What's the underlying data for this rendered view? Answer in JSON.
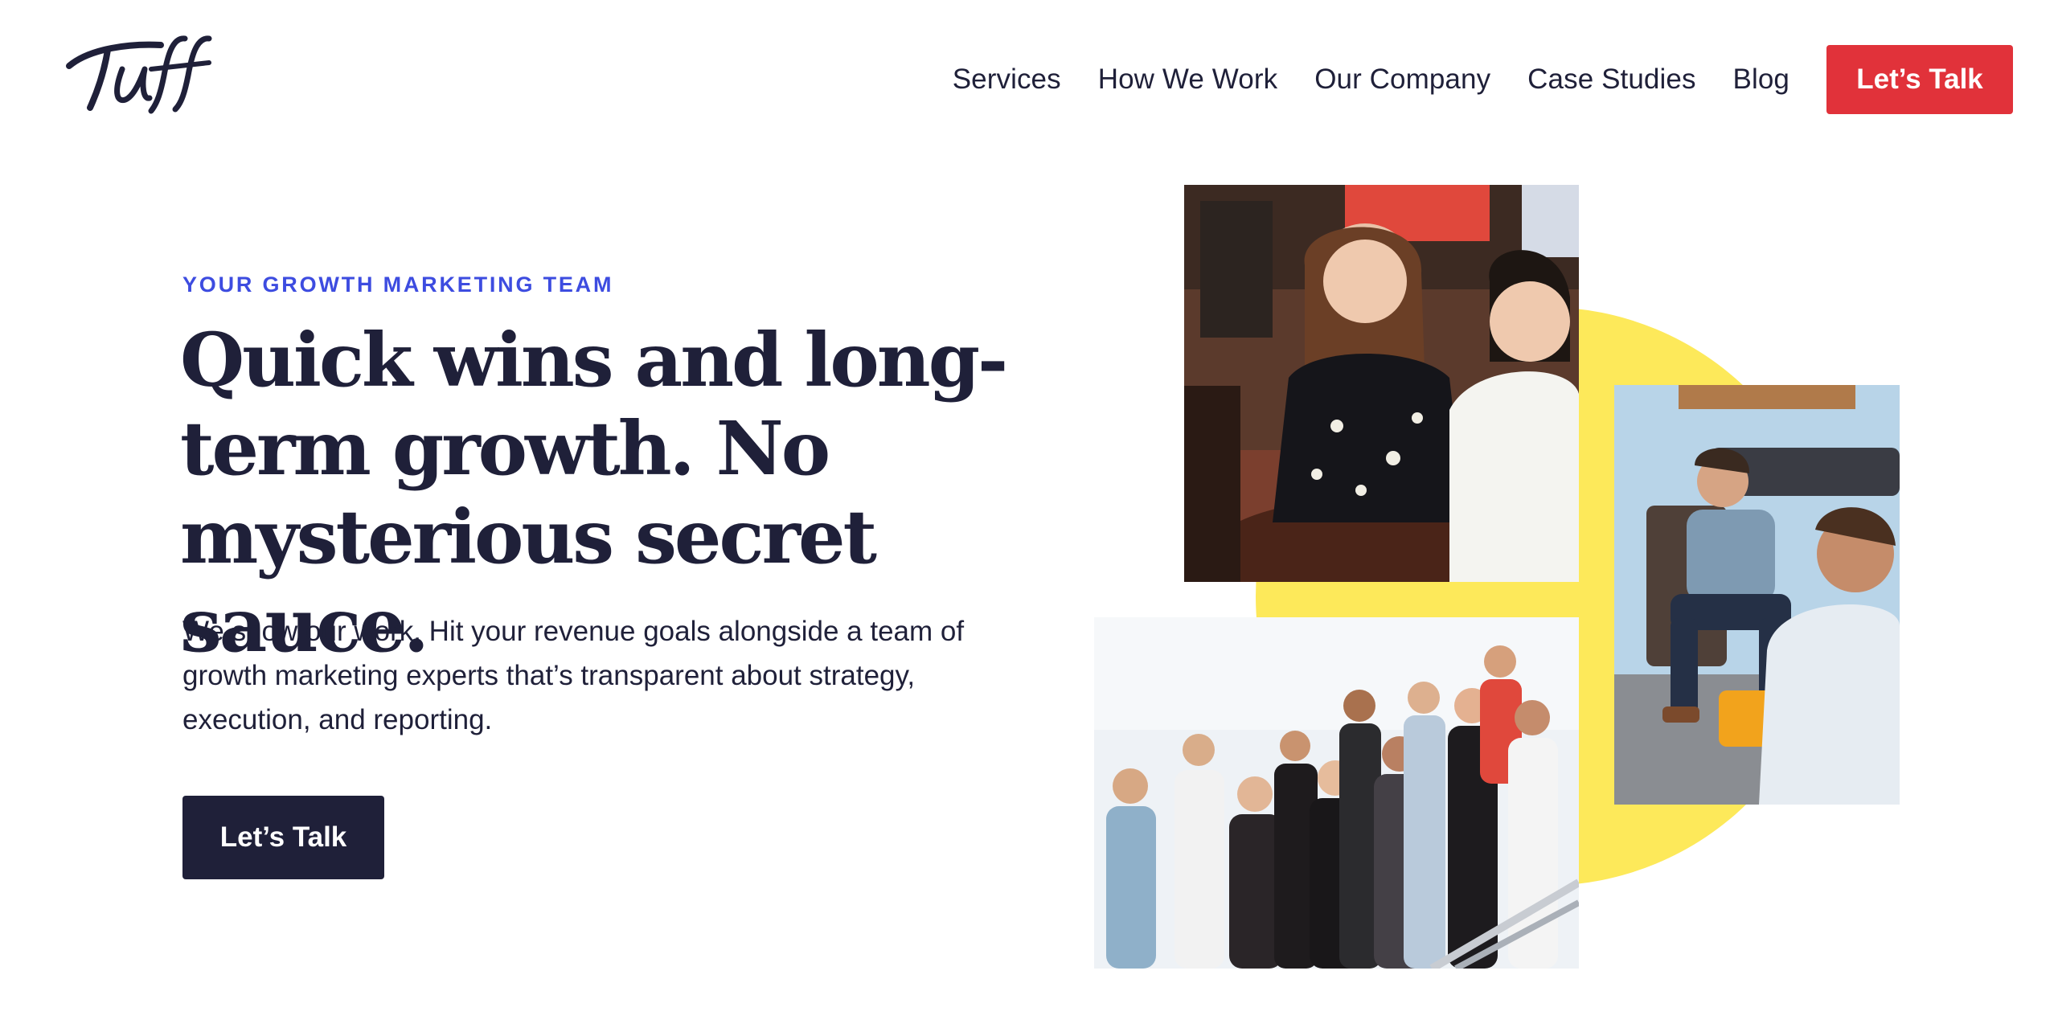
{
  "header": {
    "logo_text": "Tuff",
    "nav": [
      {
        "label": "Services"
      },
      {
        "label": "How We Work"
      },
      {
        "label": "Our Company"
      },
      {
        "label": "Case Studies"
      },
      {
        "label": "Blog"
      }
    ],
    "cta_label": "Let’s Talk"
  },
  "hero": {
    "eyebrow": "YOUR GROWTH MARKETING TEAM",
    "headline": "Quick wins and long-term growth. No mysterious secret sauce.",
    "subtext": "We show our work. Hit your revenue goals alongside a team of growth marketing experts that’s transparent about strategy, execution, and reporting.",
    "cta_label": "Let’s Talk"
  },
  "colors": {
    "brand_navy": "#1f2039",
    "accent_red": "#e1323a",
    "eyebrow_blue": "#3d4ce0",
    "accent_yellow": "#fde95a"
  }
}
